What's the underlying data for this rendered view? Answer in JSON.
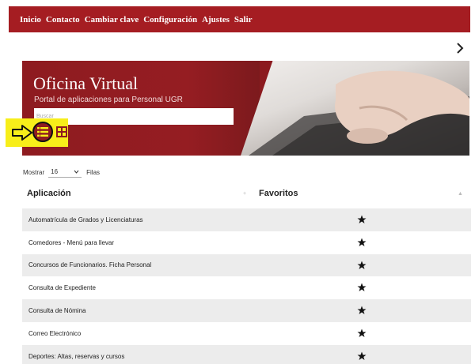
{
  "nav": {
    "items": [
      "Inicio",
      "Contacto",
      "Cambiar clave",
      "Configuración",
      "Ajustes",
      "Salir"
    ]
  },
  "hero": {
    "title": "Oficina Virtual",
    "subtitle": "Portal de aplicaciones para Personal UGR",
    "search_placeholder": "Buscar"
  },
  "pagination": {
    "show_label": "Mostrar",
    "rows_value": "16",
    "rows_label": "Filas"
  },
  "table": {
    "columns": [
      "Aplicación",
      "Favoritos"
    ],
    "rows": [
      {
        "app": "Automatrícula de Grados y Licenciaturas",
        "favorite": true
      },
      {
        "app": "Comedores - Menú para llevar",
        "favorite": true
      },
      {
        "app": "Concursos de Funcionarios. Ficha Personal",
        "favorite": true
      },
      {
        "app": "Consulta de Expediente",
        "favorite": true
      },
      {
        "app": "Consulta de Nómina",
        "favorite": true
      },
      {
        "app": "Correo Electrónico",
        "favorite": true
      },
      {
        "app": "Deportes: Altas, reservas y cursos",
        "favorite": true
      }
    ]
  },
  "icons": {
    "next": "chevron-right-icon",
    "list_view": "list-view-icon",
    "grid_view": "grid-view-icon",
    "pointer_arrow": "arrow-right-icon",
    "favorite": "star-icon",
    "sort": "sort-icon"
  },
  "colors": {
    "brand": "#a51d22",
    "highlight": "#f7ee1a",
    "row_alt": "#ececec"
  }
}
